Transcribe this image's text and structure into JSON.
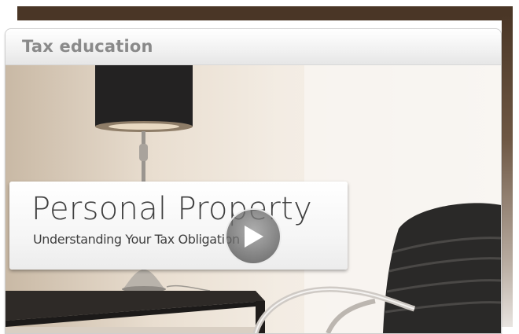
{
  "panel": {
    "title": "Tax education"
  },
  "video": {
    "title_card": {
      "title": "Personal Property",
      "subtitle": "Understanding Your Tax Obligation"
    },
    "play_button_icon": "play-icon"
  },
  "colors": {
    "top_bar": "#4a3626",
    "panel_title": "#8a8a8a",
    "card_text": "#3f3f3f"
  }
}
